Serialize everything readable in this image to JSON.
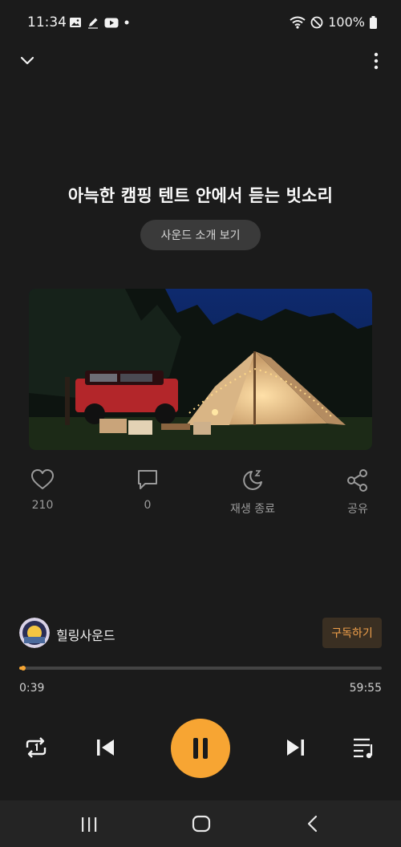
{
  "status_bar": {
    "time": "11:34",
    "battery": "100%",
    "icons": [
      "image-icon",
      "pen-icon",
      "youtube-icon",
      "dot-icon",
      "wifi-icon",
      "dnd-icon",
      "battery-icon"
    ]
  },
  "top_bar": {
    "icons": [
      "chevron-down-icon",
      "more-vert-icon"
    ]
  },
  "track": {
    "title": "아늑한 캠핑 텐트 안에서 듣는 빗소리",
    "intro_button": "사운드 소개 보기"
  },
  "actions": {
    "like_count": "210",
    "comment_count": "0",
    "sleep_timer_label": "재생 종료",
    "share_label": "공유"
  },
  "channel": {
    "name": "힐링사운드",
    "subscribe_label": "구독하기"
  },
  "player": {
    "current_time": "0:39",
    "total_time": "59:55",
    "progress_fraction": 0.0108
  },
  "colors": {
    "accent": "#f7a533",
    "background": "#1b1b1b",
    "subscribe_text": "#f0a04b"
  }
}
